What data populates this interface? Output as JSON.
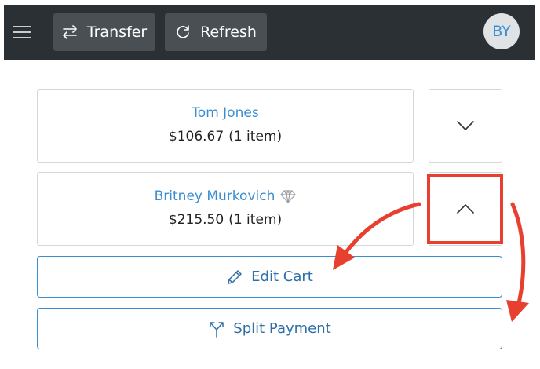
{
  "header": {
    "menu_icon": "hamburger-icon",
    "transfer_label": "Transfer",
    "transfer_icon": "swap-arrows-icon",
    "refresh_label": "Refresh",
    "refresh_icon": "refresh-icon",
    "avatar_initials": "BY"
  },
  "carts": [
    {
      "name": "Tom Jones",
      "total": "$106.67",
      "count": "(1 item)",
      "badge_icon": null,
      "expanded": false,
      "toggle_icon": "chevron-down-icon"
    },
    {
      "name": "Britney Murkovich",
      "total": "$215.50",
      "count": "(1 item)",
      "badge_icon": "diamond-icon",
      "expanded": true,
      "toggle_icon": "chevron-up-icon"
    }
  ],
  "actions": {
    "edit_cart_label": "Edit Cart",
    "edit_cart_icon": "pencil-icon",
    "split_payment_label": "Split Payment",
    "split_payment_icon": "split-arrow-icon"
  },
  "annotation": {
    "highlight_color": "#e8402e"
  },
  "colors": {
    "header_bg": "#2b3035",
    "header_button_bg": "#4a4f54",
    "accent": "#3a8dd0",
    "avatar_bg": "#dfe3e6"
  }
}
